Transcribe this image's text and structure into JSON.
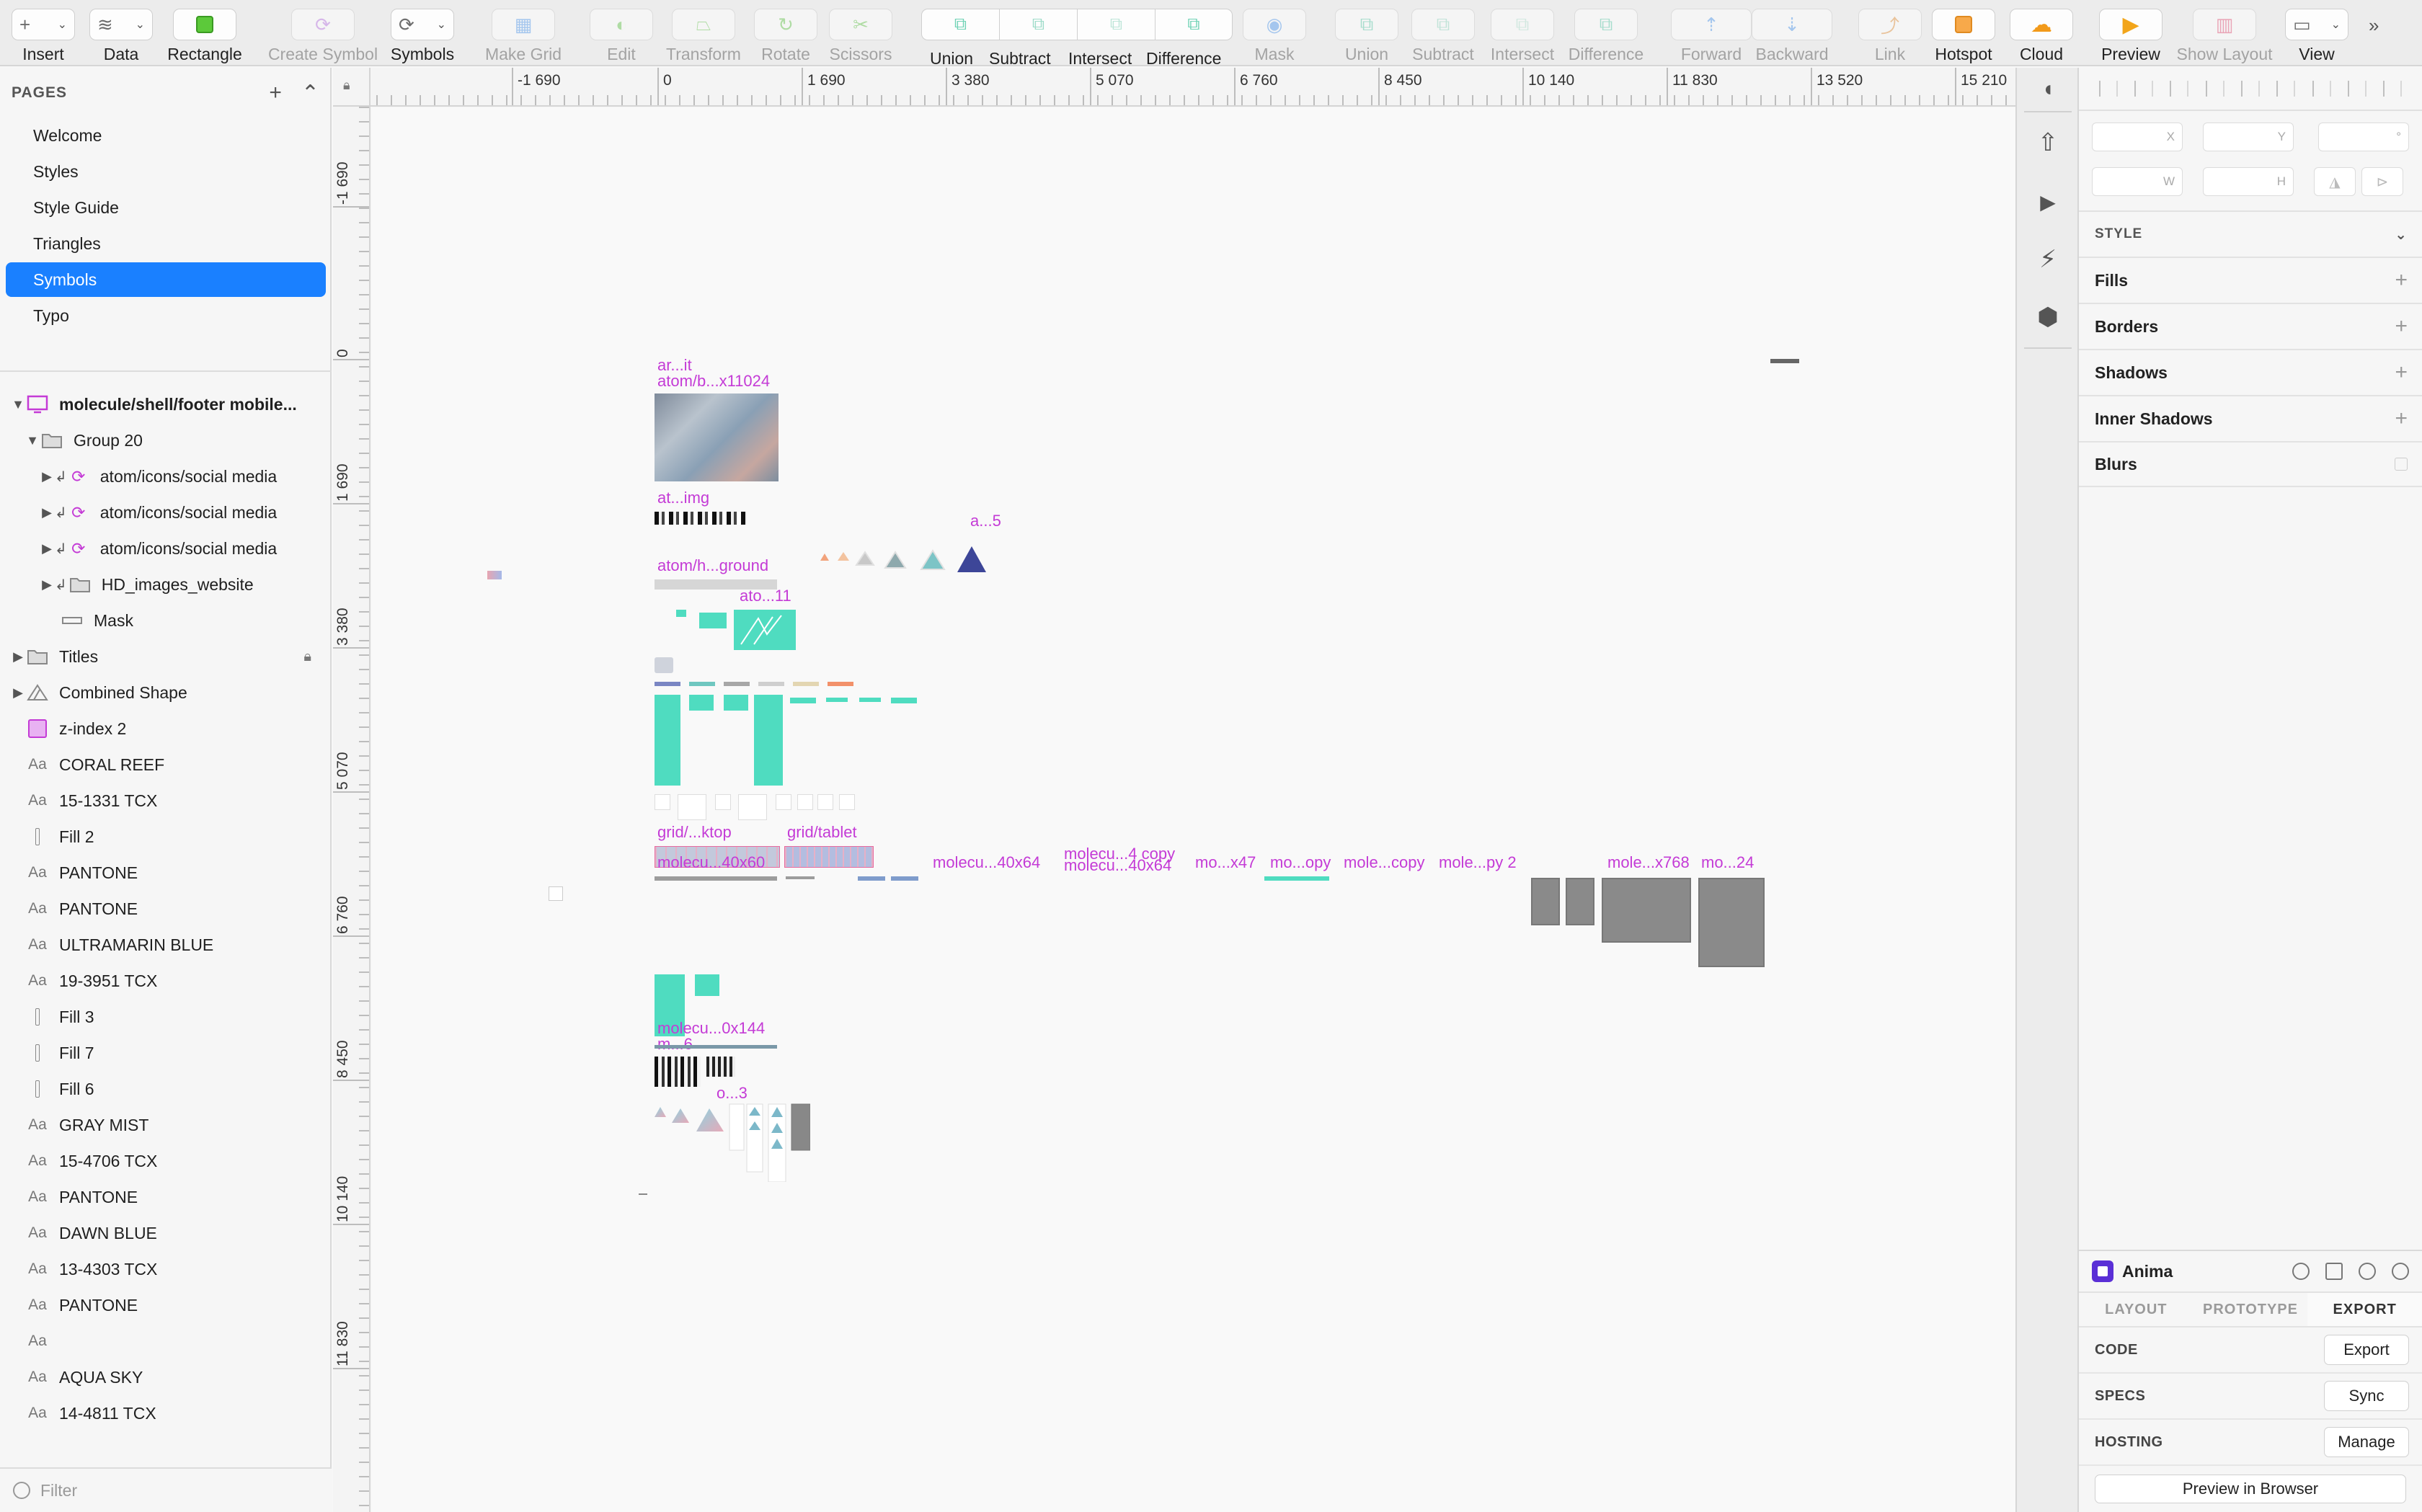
{
  "toolbar": {
    "insert": "Insert",
    "data": "Data",
    "rectangle": "Rectangle",
    "create_symbol": "Create Symbol",
    "symbols": "Symbols",
    "make_grid": "Make Grid",
    "edit": "Edit",
    "transform": "Transform",
    "rotate": "Rotate",
    "scissors": "Scissors",
    "union": "Union",
    "subtract": "Subtract",
    "intersect": "Intersect",
    "difference": "Difference",
    "mask": "Mask",
    "union2": "Union",
    "subtract2": "Subtract",
    "intersect2": "Intersect",
    "difference2": "Difference",
    "forward": "Forward",
    "backward": "Backward",
    "link": "Link",
    "hotspot": "Hotspot",
    "cloud": "Cloud",
    "preview": "Preview",
    "show_layout": "Show Layout",
    "view": "View"
  },
  "pages": {
    "header": "PAGES",
    "items": [
      "Welcome",
      "Styles",
      "Style Guide",
      "Triangles",
      "Symbols",
      "Typo"
    ],
    "selected": "Symbols"
  },
  "layers": {
    "artboard": "molecule/shell/footer mobile...",
    "group": "Group 20",
    "social1": "atom/icons/social media",
    "social2": "atom/icons/social media",
    "social3": "atom/icons/social media",
    "hd_images": "HD_images_website",
    "mask": "Mask",
    "titles": "Titles",
    "combined": "Combined Shape",
    "zindex": "z-index 2",
    "t1": "CORAL REEF",
    "t2": "15-1331 TCX",
    "f2": "Fill 2",
    "t3": "PANTONE",
    "t4": "PANTONE",
    "t5": "ULTRAMARIN BLUE",
    "t6": "19-3951 TCX",
    "f3": "Fill 3",
    "f7": "Fill 7",
    "f6": "Fill 6",
    "t7": "GRAY MIST",
    "t8": "15-4706 TCX",
    "t9": "PANTONE",
    "t10": "DAWN BLUE",
    "t11": "13-4303 TCX",
    "t12": "PANTONE",
    "t13": "",
    "t14": "AQUA SKY",
    "t15": "14-4811 TCX",
    "aa": "Aa"
  },
  "filter": {
    "placeholder": "Filter"
  },
  "ruler": {
    "top": [
      "-1 690",
      "0",
      "1 690",
      "3 380",
      "5 070",
      "6 760",
      "8 450",
      "10 140",
      "11 830",
      "13 520",
      "15 210"
    ],
    "left": [
      "-1 690",
      "0",
      "1 690",
      "3 380",
      "5 070",
      "6 760",
      "8 450",
      "10 140",
      "11 830"
    ]
  },
  "canvas": {
    "labels": {
      "l1": "ar...it",
      "l2": "atom/b...x11024",
      "l3": "at...img",
      "l4": "a...5",
      "l5": "atom/h...ground",
      "l6": "ato...11",
      "l7": "grid/...ktop",
      "l8": "grid/tablet",
      "l9": "molecu...40x60",
      "l10": "molecu...40x64",
      "l11": "molecu...4 copy",
      "l12": "molecu...40x64",
      "l13": "mo...x47",
      "l14": "mo...opy",
      "l15": "mole...copy",
      "l16": "mole...py 2",
      "l17": "mole...x768",
      "l18": "mo...24",
      "l19": "molecu...0x144",
      "l20": "m...6",
      "l21": "o...3"
    }
  },
  "inspector": {
    "x": "X",
    "y": "Y",
    "deg": "°",
    "w": "W",
    "h": "H",
    "style": "STYLE",
    "fills": "Fills",
    "borders": "Borders",
    "shadows": "Shadows",
    "inner_shadows": "Inner Shadows",
    "blurs": "Blurs"
  },
  "anima": {
    "title": "Anima",
    "tabs": [
      "LAYOUT",
      "PROTOTYPE",
      "EXPORT"
    ],
    "active_tab": "EXPORT",
    "code": "CODE",
    "code_btn": "Export",
    "specs": "SPECS",
    "specs_btn": "Sync",
    "hosting": "HOSTING",
    "hosting_btn": "Manage",
    "preview_browser": "Preview in Browser"
  },
  "colors": {
    "accent": "#1a80ff",
    "artboard_label": "#c43bd6",
    "teal": "#4fdcc0",
    "rectangle_green": "#5cc93a"
  }
}
